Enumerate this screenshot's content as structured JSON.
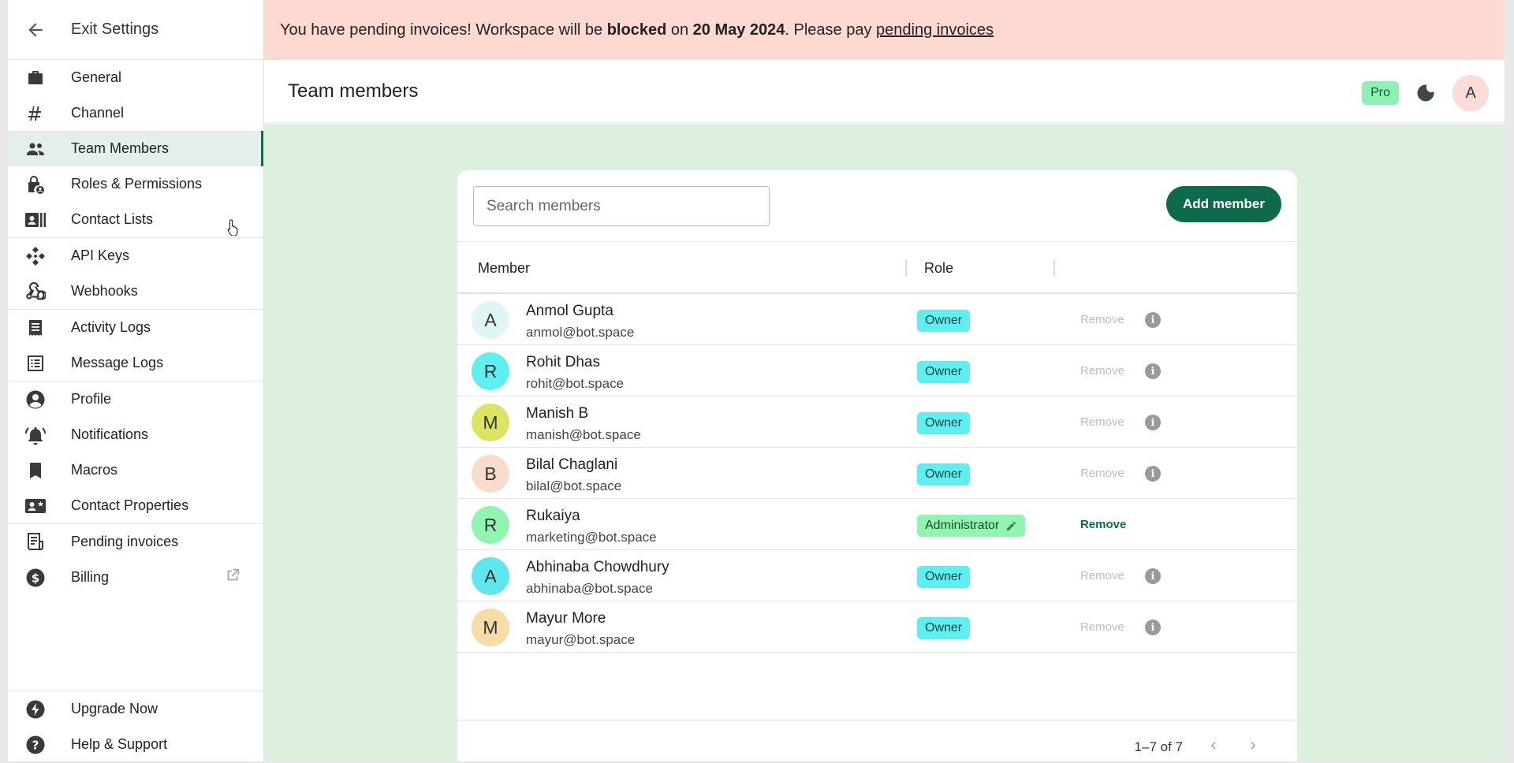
{
  "sidebar": {
    "exit_label": "Exit Settings",
    "groups": [
      [
        {
          "label": "General",
          "icon": "briefcase-icon"
        },
        {
          "label": "Channel",
          "icon": "hashtag-icon"
        },
        {
          "label": "Team Members",
          "icon": "people-icon",
          "active": true
        },
        {
          "label": "Roles & Permissions",
          "icon": "lock-user-icon"
        },
        {
          "label": "Contact Lists",
          "icon": "contact-card-icon"
        }
      ],
      [
        {
          "label": "API Keys",
          "icon": "api-icon"
        },
        {
          "label": "Webhooks",
          "icon": "webhook-icon"
        }
      ],
      [
        {
          "label": "Activity Logs",
          "icon": "receipt-icon"
        },
        {
          "label": "Message Logs",
          "icon": "list-icon"
        }
      ],
      [
        {
          "label": "Profile",
          "icon": "account-circle-icon"
        },
        {
          "label": "Notifications",
          "icon": "bell-ring-icon"
        },
        {
          "label": "Macros",
          "icon": "bookmark-icon"
        },
        {
          "label": "Contact Properties",
          "icon": "contact-star-icon"
        }
      ],
      [
        {
          "label": "Pending invoices",
          "icon": "invoice-icon"
        },
        {
          "label": "Billing",
          "icon": "dollar-circle-icon"
        }
      ]
    ],
    "bottom": [
      {
        "label": "Upgrade Now",
        "icon": "bolt-icon"
      },
      {
        "label": "Help & Support",
        "icon": "help-circle-icon"
      }
    ]
  },
  "banner": {
    "text_1": "You have pending invoices! Workspace will be ",
    "bold_1": "blocked",
    "text_2": " on ",
    "bold_2": "20 May 2024",
    "text_3": ". Please pay ",
    "link": "pending invoices"
  },
  "header": {
    "title": "Team members",
    "plan_badge": "Pro",
    "avatar_letter": "A"
  },
  "members": {
    "search_placeholder": "Search members",
    "add_label": "Add member",
    "columns": {
      "member": "Member",
      "role": "Role"
    },
    "rows": [
      {
        "initial": "A",
        "name": "Anmol Gupta",
        "email": "anmol@bot.space",
        "role": "Owner",
        "remove": "Remove",
        "avatar_color": "#e0f6f6"
      },
      {
        "initial": "R",
        "name": "Rohit Dhas",
        "email": "rohit@bot.space",
        "role": "Owner",
        "remove": "Remove",
        "avatar_color": "#5ef0ef"
      },
      {
        "initial": "M",
        "name": "Manish B",
        "email": "manish@bot.space",
        "role": "Owner",
        "remove": "Remove",
        "avatar_color": "#dde463"
      },
      {
        "initial": "B",
        "name": "Bilal Chaglani",
        "email": "bilal@bot.space",
        "role": "Owner",
        "remove": "Remove",
        "avatar_color": "#f7dccd"
      },
      {
        "initial": "R",
        "name": "Rukaiya",
        "email": "marketing@bot.space",
        "role": "Administrator",
        "remove": "Remove",
        "avatar_color": "#8ff5b0"
      },
      {
        "initial": "A",
        "name": "Abhinaba Chowdhury",
        "email": "abhinaba@bot.space",
        "role": "Owner",
        "remove": "Remove",
        "avatar_color": "#5ee8ee"
      },
      {
        "initial": "M",
        "name": "Mayur More",
        "email": "mayur@bot.space",
        "role": "Owner",
        "remove": "Remove",
        "avatar_color": "#f7dca6"
      }
    ],
    "pagination": "1–7 of 7"
  },
  "colors": {
    "accent": "#0d6b4b",
    "banner_bg": "#fdd9d2",
    "content_bg": "#ddefdf"
  }
}
